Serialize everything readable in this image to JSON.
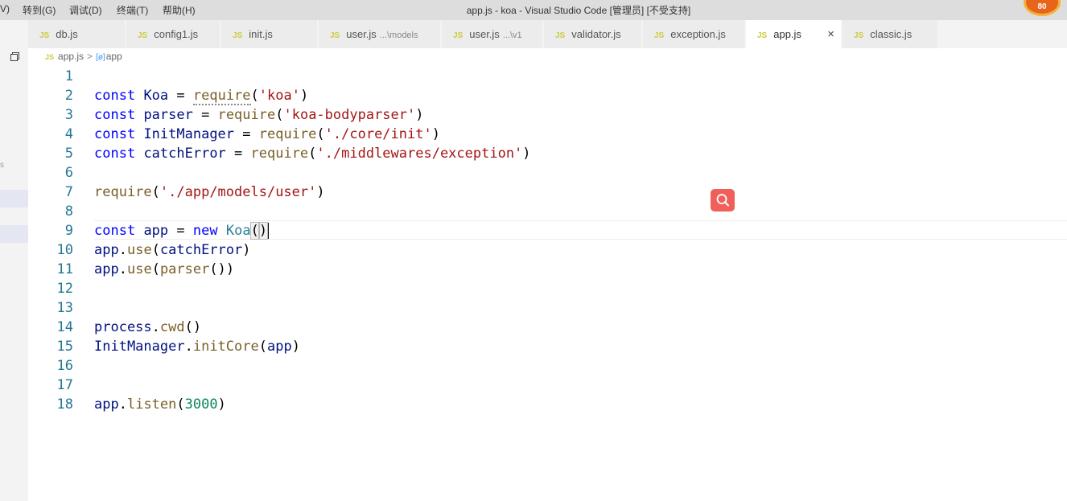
{
  "menu": {
    "partial": "V)",
    "items": [
      "转到(G)",
      "调试(D)",
      "终端(T)",
      "帮助(H)"
    ]
  },
  "window_title": "app.js - koa - Visual Studio Code [管理员] [不受支持]",
  "badge_text": "80",
  "tabs": [
    {
      "label": "db.js",
      "desc": ""
    },
    {
      "label": "config1.js",
      "desc": ""
    },
    {
      "label": "init.js",
      "desc": ""
    },
    {
      "label": "user.js",
      "desc": "...\\models"
    },
    {
      "label": "user.js",
      "desc": "...\\v1"
    },
    {
      "label": "validator.js",
      "desc": ""
    },
    {
      "label": "exception.js",
      "desc": ""
    },
    {
      "label": "app.js",
      "desc": ""
    },
    {
      "label": "classic.js",
      "desc": ""
    }
  ],
  "tab_icon_text": "JS",
  "close_glyph": "×",
  "breadcrumb": {
    "file": "app.js",
    "separator": ">",
    "symbol_icon": "[ø]",
    "symbol": "app"
  },
  "left_tick": "s",
  "lines": [
    {
      "n": "1",
      "tokens": []
    },
    {
      "n": "2",
      "tokens": [
        [
          "kw",
          "const"
        ],
        [
          "p",
          " "
        ],
        [
          "var",
          "Koa"
        ],
        [
          "p",
          " = "
        ],
        [
          "fnsq",
          "require"
        ],
        [
          "p",
          "("
        ],
        [
          "str",
          "'koa'"
        ],
        [
          "p",
          ")"
        ]
      ]
    },
    {
      "n": "3",
      "tokens": [
        [
          "kw",
          "const"
        ],
        [
          "p",
          " "
        ],
        [
          "var",
          "parser"
        ],
        [
          "p",
          " = "
        ],
        [
          "fn",
          "require"
        ],
        [
          "p",
          "("
        ],
        [
          "str",
          "'koa-bodyparser'"
        ],
        [
          "p",
          ")"
        ]
      ]
    },
    {
      "n": "4",
      "tokens": [
        [
          "kw",
          "const"
        ],
        [
          "p",
          " "
        ],
        [
          "var",
          "InitManager"
        ],
        [
          "p",
          " = "
        ],
        [
          "fn",
          "require"
        ],
        [
          "p",
          "("
        ],
        [
          "str",
          "'./core/init'"
        ],
        [
          "p",
          ")"
        ]
      ]
    },
    {
      "n": "5",
      "tokens": [
        [
          "kw",
          "const"
        ],
        [
          "p",
          " "
        ],
        [
          "var",
          "catchError"
        ],
        [
          "p",
          " = "
        ],
        [
          "fn",
          "require"
        ],
        [
          "p",
          "("
        ],
        [
          "str",
          "'./middlewares/exception'"
        ],
        [
          "p",
          ")"
        ]
      ]
    },
    {
      "n": "6",
      "tokens": []
    },
    {
      "n": "7",
      "tokens": [
        [
          "fn",
          "require"
        ],
        [
          "p",
          "("
        ],
        [
          "str",
          "'./app/models/user'"
        ],
        [
          "p",
          ")"
        ]
      ]
    },
    {
      "n": "8",
      "tokens": []
    },
    {
      "n": "9",
      "tokens": [
        [
          "kw",
          "const"
        ],
        [
          "p",
          " "
        ],
        [
          "var",
          "app"
        ],
        [
          "p",
          " = "
        ],
        [
          "kw",
          "new"
        ],
        [
          "p",
          " "
        ],
        [
          "cls",
          "Koa"
        ],
        [
          "br",
          "("
        ],
        [
          "br",
          ")"
        ],
        [
          "cur",
          ""
        ]
      ]
    },
    {
      "n": "10",
      "tokens": [
        [
          "var",
          "app"
        ],
        [
          "p",
          "."
        ],
        [
          "fn",
          "use"
        ],
        [
          "p",
          "("
        ],
        [
          "var",
          "catchError"
        ],
        [
          "p",
          ")"
        ]
      ]
    },
    {
      "n": "11",
      "tokens": [
        [
          "var",
          "app"
        ],
        [
          "p",
          "."
        ],
        [
          "fn",
          "use"
        ],
        [
          "p",
          "("
        ],
        [
          "fn",
          "parser"
        ],
        [
          "p",
          "())"
        ]
      ]
    },
    {
      "n": "12",
      "tokens": []
    },
    {
      "n": "13",
      "tokens": []
    },
    {
      "n": "14",
      "tokens": [
        [
          "var",
          "process"
        ],
        [
          "p",
          "."
        ],
        [
          "fn",
          "cwd"
        ],
        [
          "p",
          "()"
        ]
      ]
    },
    {
      "n": "15",
      "tokens": [
        [
          "var",
          "InitManager"
        ],
        [
          "p",
          "."
        ],
        [
          "fn",
          "initCore"
        ],
        [
          "p",
          "("
        ],
        [
          "var",
          "app"
        ],
        [
          "p",
          ")"
        ]
      ]
    },
    {
      "n": "16",
      "tokens": []
    },
    {
      "n": "17",
      "tokens": []
    },
    {
      "n": "18",
      "tokens": [
        [
          "var",
          "app"
        ],
        [
          "p",
          "."
        ],
        [
          "fn",
          "listen"
        ],
        [
          "p",
          "("
        ],
        [
          "num",
          "3000"
        ],
        [
          "p",
          ")"
        ]
      ]
    }
  ],
  "colors": {
    "keyword": "#0000ff",
    "variable": "#001080",
    "function": "#795e26",
    "string": "#a31515",
    "number": "#098658",
    "class": "#267f99",
    "line_number": "#237893",
    "search_button": "#f0605b"
  }
}
